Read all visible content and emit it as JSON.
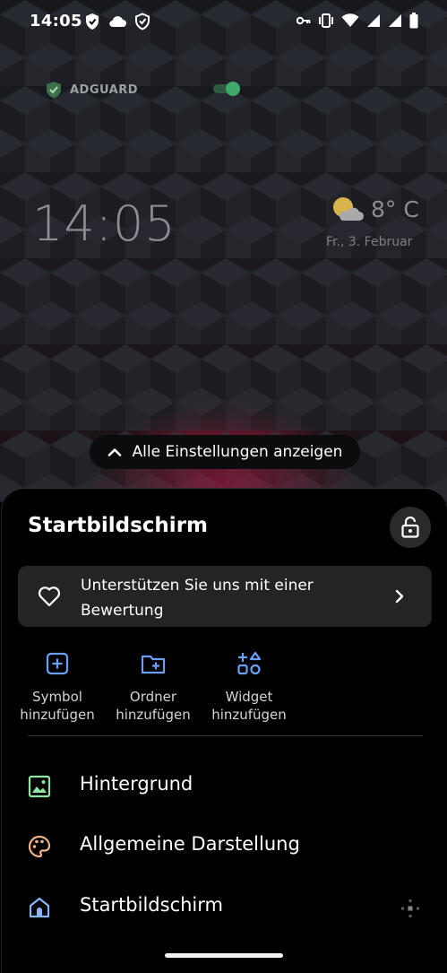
{
  "status_bar": {
    "time": "14:05",
    "left_icons": [
      "adguard-shield-icon",
      "cloud-icon",
      "shield-check-icon"
    ],
    "right_icons": [
      "vpn-key-icon",
      "vibrate-icon",
      "wifi-icon",
      "signal-icon",
      "signal-icon",
      "battery-icon"
    ]
  },
  "home_widgets": {
    "adguard_label": "ADGUARD",
    "adguard_toggle_on": true,
    "clock": "14:05",
    "weather_temp": "8° C",
    "weather_date": "Fr., 3. Februar",
    "weather_icon": "partly-cloudy-icon"
  },
  "all_settings_label": "Alle Einstellungen anzeigen",
  "sheet": {
    "title": "Startbildschirm",
    "rating_text": "Unterstützen Sie uns mit einer Bewertung",
    "quick_actions": [
      {
        "label": "Symbol hinzufügen",
        "icon": "add-square-icon"
      },
      {
        "label": "Ordner hinzufügen",
        "icon": "add-folder-icon"
      },
      {
        "label": "Widget hinzufügen",
        "icon": "widgets-icon"
      }
    ],
    "menu": [
      {
        "label": "Hintergrund",
        "icon": "image-icon",
        "color": "#8ee6a5"
      },
      {
        "label": "Allgemeine Darstellung",
        "icon": "palette-icon",
        "color": "#f2b287"
      },
      {
        "label": "Startbildschirm",
        "icon": "home-icon",
        "color": "#8ab4f8"
      }
    ]
  },
  "colors": {
    "accent_blue": "#6aa0f5",
    "card_bg": "#242426",
    "toggle_green": "#3fa86b"
  }
}
